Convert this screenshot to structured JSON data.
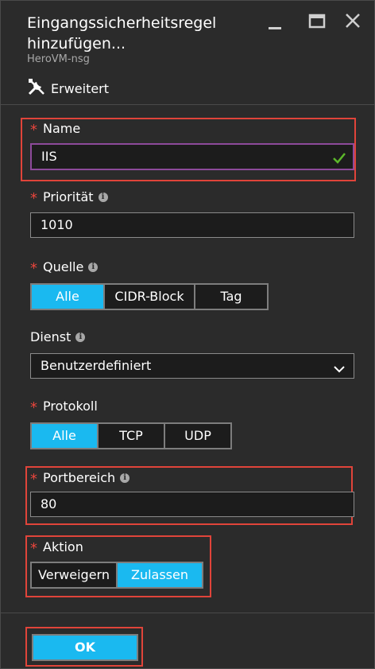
{
  "blade": {
    "title": "Eingangssicherheitsregel hinzufügen...",
    "subtitle": "HeroVM-nsg"
  },
  "window_controls": {
    "minimize": "minimize-icon",
    "maximize": "maximize-icon",
    "close": "close-icon"
  },
  "command": {
    "label": "Erweitert",
    "icon": "tools-icon"
  },
  "fields": {
    "name": {
      "label": "Name",
      "value": "IIS",
      "required": true
    },
    "priority": {
      "label": "Priorität",
      "value": "1010",
      "required": true
    },
    "source": {
      "label": "Quelle",
      "required": true,
      "options": [
        "Alle",
        "CIDR-Block",
        "Tag"
      ],
      "selected": "Alle"
    },
    "service": {
      "label": "Dienst",
      "value": "Benutzerdefiniert"
    },
    "protocol": {
      "label": "Protokoll",
      "required": true,
      "options": [
        "Alle",
        "TCP",
        "UDP"
      ],
      "selected": "Alle"
    },
    "port_range": {
      "label": "Portbereich",
      "value": "80",
      "required": true
    },
    "action": {
      "label": "Aktion",
      "required": true,
      "options": [
        "Verweigern",
        "Zulassen"
      ],
      "selected": "Zulassen"
    }
  },
  "required_marker": "*",
  "ok_button": "OK",
  "colors": {
    "accent": "#1ab9f0",
    "highlight": "#e0443a",
    "required": "#e8453c",
    "valid": "#5cb82a",
    "background": "#2b2b2b"
  }
}
